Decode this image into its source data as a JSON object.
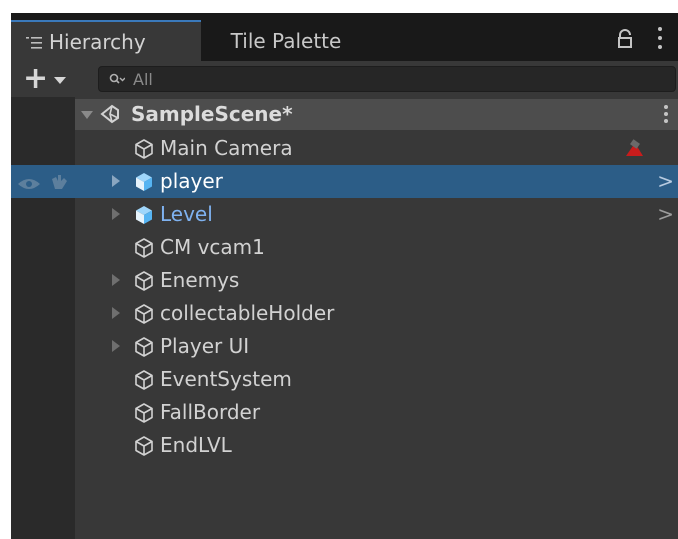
{
  "tabs": [
    {
      "label": "Hierarchy",
      "active": true
    },
    {
      "label": "Tile Palette",
      "active": false
    }
  ],
  "toolbar": {
    "add_label": "+",
    "search_placeholder": "All"
  },
  "scene": {
    "name": "SampleScene*"
  },
  "objects": [
    {
      "name": "Main Camera",
      "has_children": false,
      "icon": "gameobject-icon",
      "badge": "camera-gizmo-icon"
    },
    {
      "name": "player",
      "has_children": true,
      "icon": "prefab-icon",
      "selected": true
    },
    {
      "name": "Level",
      "has_children": true,
      "icon": "prefab-icon",
      "prefab_text_color": "#7fb2f0"
    },
    {
      "name": "CM vcam1",
      "has_children": false,
      "icon": "gameobject-icon"
    },
    {
      "name": "Enemys",
      "has_children": true,
      "icon": "gameobject-icon"
    },
    {
      "name": "collectableHolder",
      "has_children": true,
      "icon": "gameobject-icon"
    },
    {
      "name": "Player UI",
      "has_children": true,
      "icon": "gameobject-icon"
    },
    {
      "name": "EventSystem",
      "has_children": false,
      "icon": "gameobject-icon"
    },
    {
      "name": "FallBorder",
      "has_children": false,
      "icon": "gameobject-icon"
    },
    {
      "name": "EndLVL",
      "has_children": false,
      "icon": "gameobject-icon"
    }
  ],
  "colors": {
    "selection": "#2c5d87",
    "active_tab_accent": "#3a79bb",
    "prefab_icon": "#56b4f2"
  }
}
